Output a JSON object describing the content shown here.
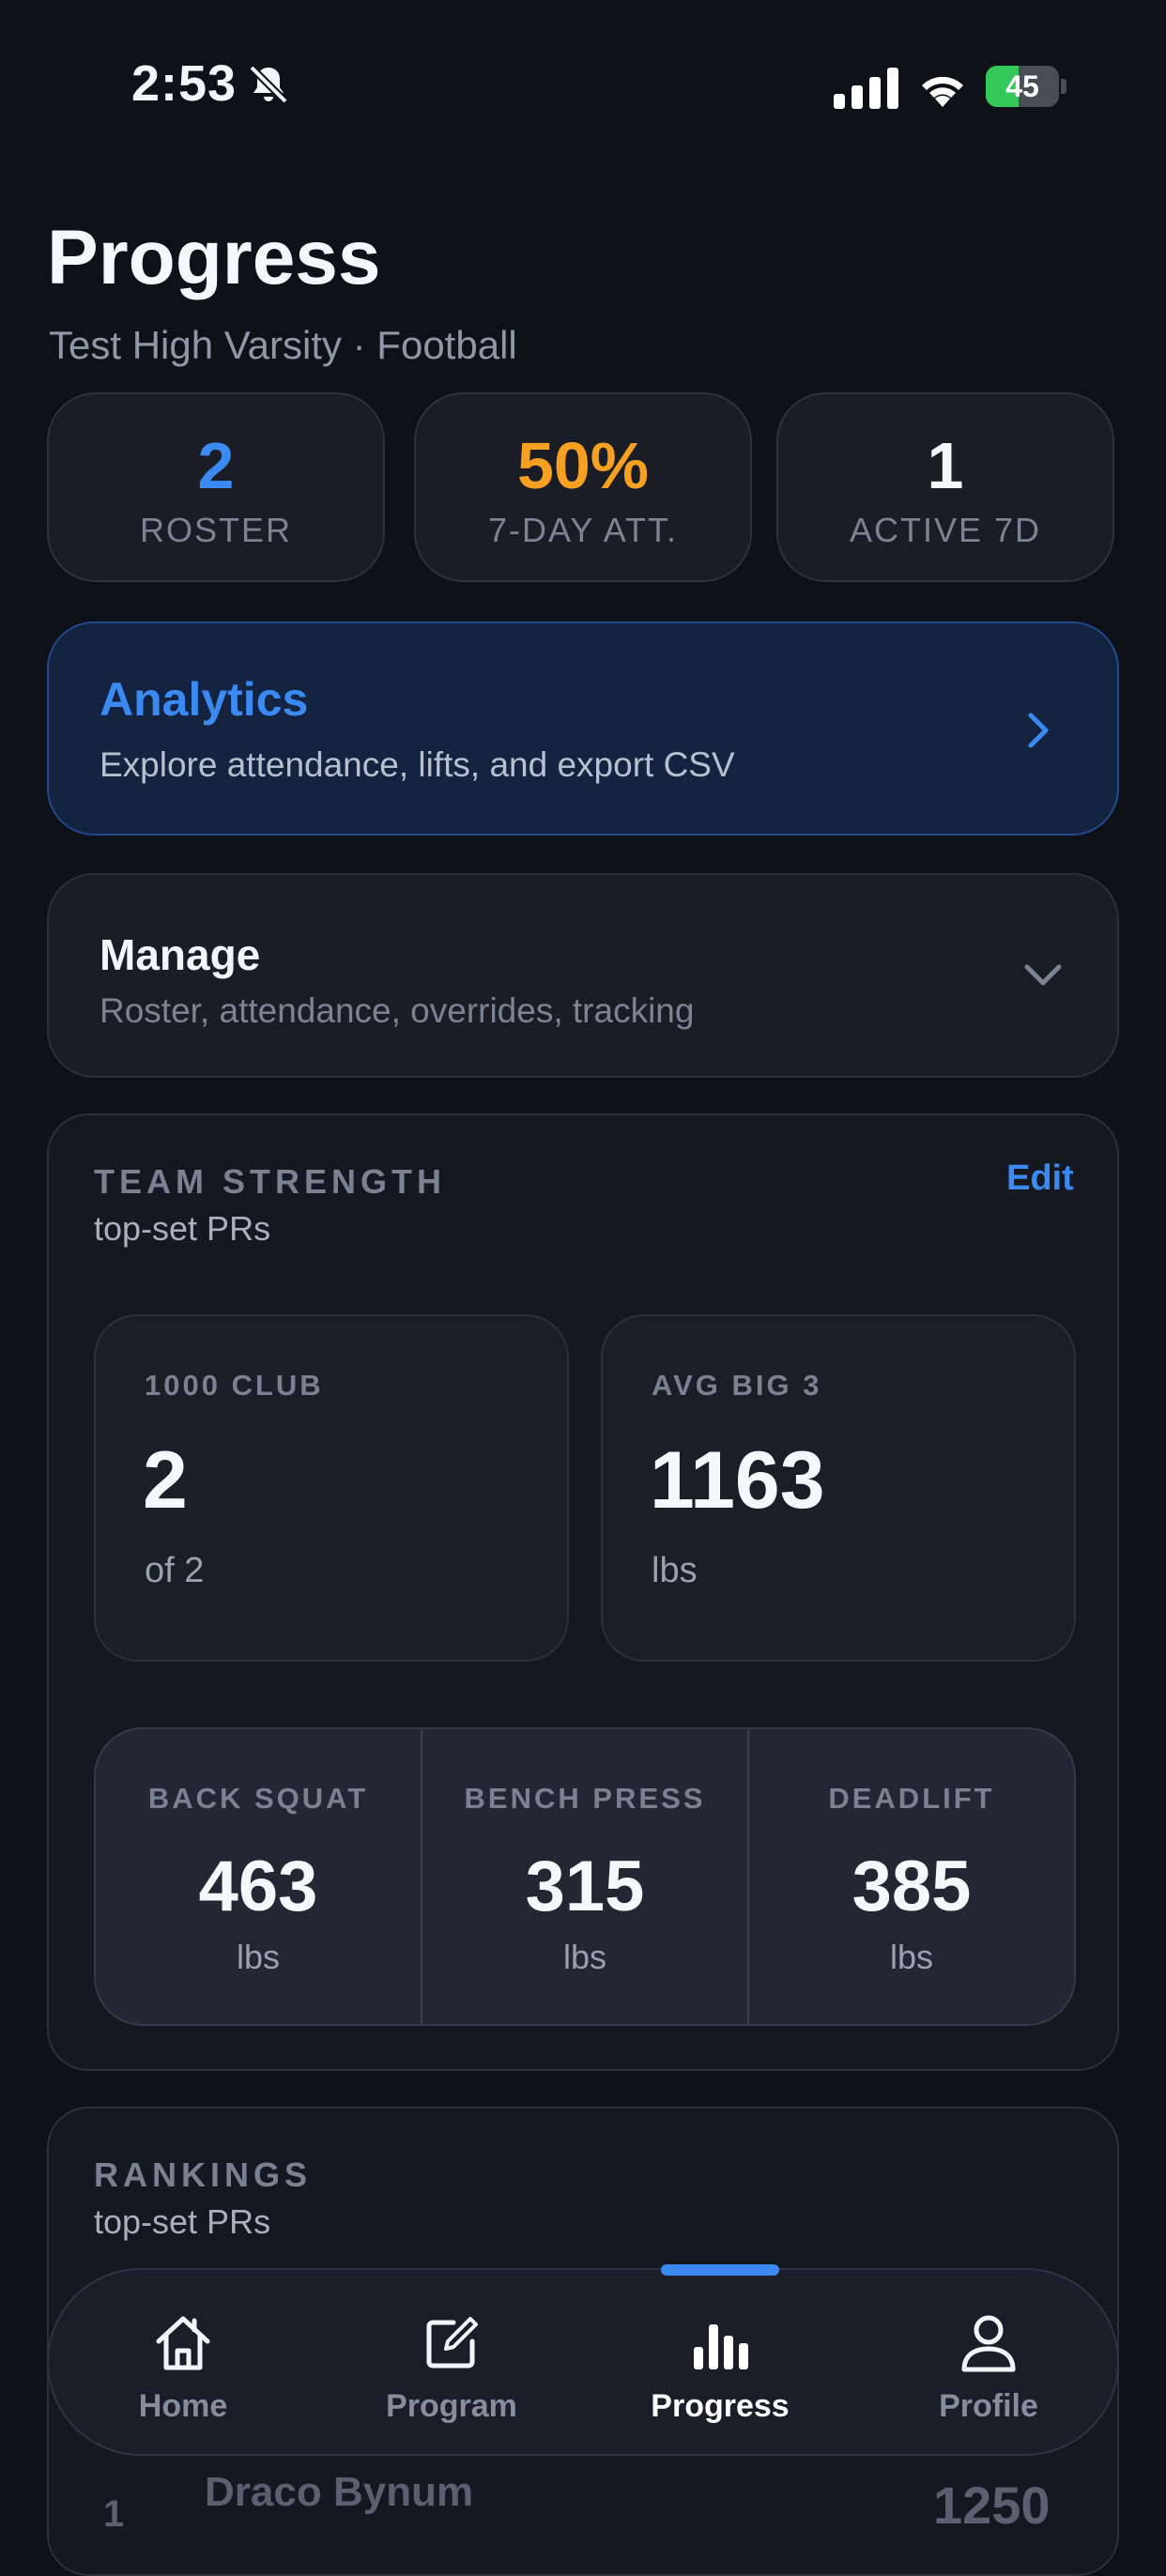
{
  "status_bar": {
    "time": "2:53",
    "battery_level": "45",
    "battery_fraction": 0.45
  },
  "header": {
    "title": "Progress",
    "subtitle": "Test High Varsity · Football"
  },
  "stats": [
    {
      "value": "2",
      "label": "ROSTER",
      "color": "#3b8af2"
    },
    {
      "value": "50%",
      "label": "7-DAY ATT.",
      "color": "#f5a020"
    },
    {
      "value": "1",
      "label": "ACTIVE 7D",
      "color": "#f6f7fa"
    }
  ],
  "analytics": {
    "title": "Analytics",
    "description": "Explore attendance, lifts, and export CSV"
  },
  "manage": {
    "title": "Manage",
    "description": "Roster, attendance, overrides, tracking"
  },
  "team_strength": {
    "title": "TEAM STRENGTH",
    "subtitle": "top-set PRs",
    "edit_label": "Edit",
    "club": {
      "label": "1000 CLUB",
      "value": "2",
      "unit": "of 2"
    },
    "avg": {
      "label": "AVG BIG 3",
      "value": "1163",
      "unit": "lbs"
    },
    "lifts": [
      {
        "label": "BACK SQUAT",
        "value": "463",
        "unit": "lbs"
      },
      {
        "label": "BENCH PRESS",
        "value": "315",
        "unit": "lbs"
      },
      {
        "label": "DEADLIFT",
        "value": "385",
        "unit": "lbs"
      }
    ]
  },
  "rankings": {
    "title": "RANKINGS",
    "subtitle": "top-set PRs",
    "rows": [
      {
        "rank": "1",
        "name": "Draco Bynum",
        "total": "1250"
      }
    ]
  },
  "tabs": [
    {
      "label": "Home",
      "icon": "home-icon",
      "active": false
    },
    {
      "label": "Program",
      "icon": "edit-icon",
      "active": false
    },
    {
      "label": "Progress",
      "icon": "bar-chart-icon",
      "active": true
    },
    {
      "label": "Profile",
      "icon": "person-icon",
      "active": false
    }
  ],
  "colors": {
    "accent": "#3b8af2",
    "warning": "#f5a020",
    "background": "#0e1118",
    "battery": "#34c759"
  }
}
